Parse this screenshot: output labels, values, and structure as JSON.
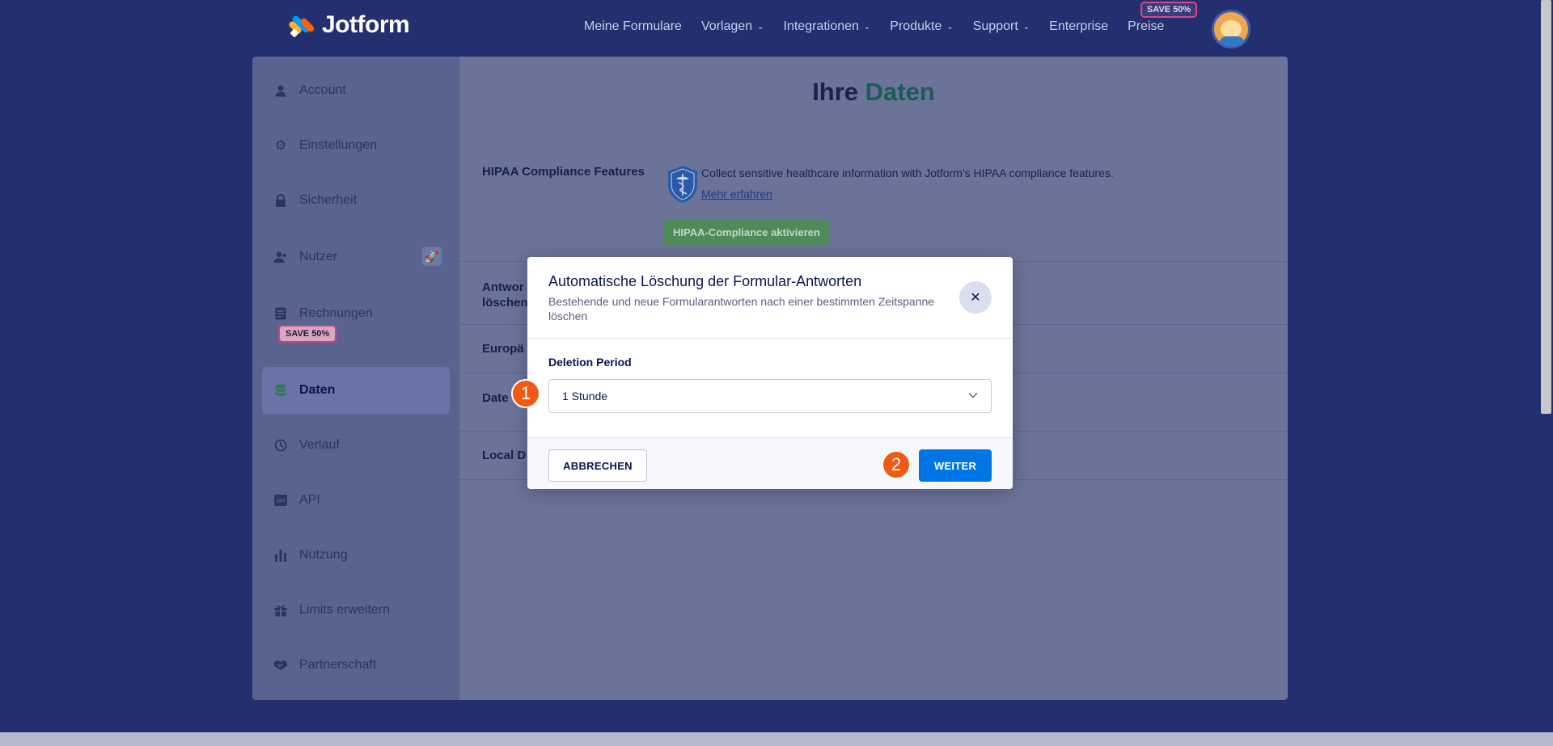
{
  "brand": {
    "name": "Jotform"
  },
  "nav": {
    "items": [
      {
        "label": "Meine Formulare",
        "dropdown": false
      },
      {
        "label": "Vorlagen",
        "dropdown": true
      },
      {
        "label": "Integrationen",
        "dropdown": true
      },
      {
        "label": "Produkte",
        "dropdown": true
      },
      {
        "label": "Support",
        "dropdown": true
      },
      {
        "label": "Enterprise",
        "dropdown": false
      },
      {
        "label": "Preise",
        "dropdown": false
      }
    ],
    "promo_badge": "SAVE 50%"
  },
  "sidebar": {
    "items": [
      {
        "label": "Account",
        "icon": "user-icon"
      },
      {
        "label": "Einstellungen",
        "icon": "gear-icon"
      },
      {
        "label": "Sicherheit",
        "icon": "lock-icon"
      },
      {
        "label": "Nutzer",
        "icon": "users-icon"
      },
      {
        "label": "Rechnungen",
        "icon": "invoice-icon"
      },
      {
        "label": "Daten",
        "icon": "database-icon",
        "active": true
      },
      {
        "label": "Verlauf",
        "icon": "history-icon"
      },
      {
        "label": "API",
        "icon": "api-icon"
      },
      {
        "label": "Nutzung",
        "icon": "bar-chart-icon"
      },
      {
        "label": "Limits erweitern",
        "icon": "gift-icon"
      },
      {
        "label": "Partnerschaft",
        "icon": "handshake-icon"
      }
    ],
    "promo_badge": "SAVE 50%"
  },
  "page": {
    "title_part1": "Ihre",
    "title_part2": "Daten",
    "rows": [
      {
        "label": "HIPAA Compliance Features"
      },
      {
        "label": "Antwor\nlöschen"
      },
      {
        "label": "Europä"
      },
      {
        "label": "Date"
      },
      {
        "label": "Local D"
      }
    ],
    "hipaa": {
      "text": "Collect sensitive healthcare information with Jotform's HIPAA compliance features.",
      "link": "Mehr erfahren",
      "button": "HIPAA-Compliance aktivieren"
    }
  },
  "dialog": {
    "title": "Automatische Löschung der Formular-Antworten",
    "subtitle": "Bestehende und neue Formularantworten nach einer bestimmten Zeitspanne löschen",
    "close_symbol": "✕",
    "field_label": "Deletion Period",
    "selected_value": "1 Stunde",
    "cancel_label": "ABBRECHEN",
    "next_label": "WEITER"
  },
  "markers": {
    "one": "1",
    "two": "2"
  },
  "colors": {
    "accent": "#0075e3",
    "marker": "#f05a14",
    "title_accent": "#1f5b55"
  }
}
